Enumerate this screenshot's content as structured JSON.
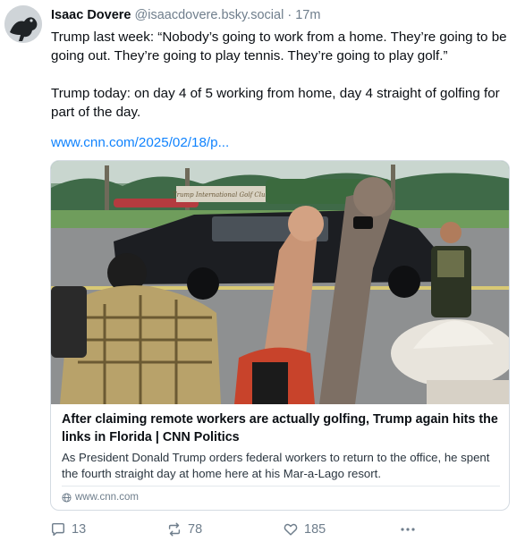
{
  "post": {
    "author": {
      "display_name": "Isaac Dovere",
      "handle": "@isaacdovere.bsky.social",
      "separator": "·",
      "time": "17m"
    },
    "text_line1": "Trump last week: “Nobody’s going to work from a home. They’re going to be going out. They’re going to play tennis. They’re going to play golf.”",
    "text_line2": "Trump today: on day 4 of 5 working from home, day 4 straight of golfing for part of the day.",
    "link": "www.cnn.com/2025/02/18/p..."
  },
  "embed": {
    "title": "After claiming remote workers are actually golfing, Trump again hits the links in Florida | CNN Politics",
    "description": "As President Donald Trump orders federal workers to return to the office, he spent the fourth straight day at home here at his Mar-a-Lago resort.",
    "domain": "www.cnn.com",
    "image_sign_text": "Trump International Golf Club"
  },
  "actions": {
    "reply_count": "13",
    "repost_count": "78",
    "like_count": "185"
  },
  "icons": {
    "avatar": "avatar-image",
    "reply": "reply-icon",
    "repost": "repost-icon",
    "like": "heart-icon",
    "more": "more-icon",
    "globe": "globe-icon"
  },
  "colors": {
    "link": "#1083fe",
    "muted": "#6f7e8c",
    "border": "#d4dbe2"
  }
}
